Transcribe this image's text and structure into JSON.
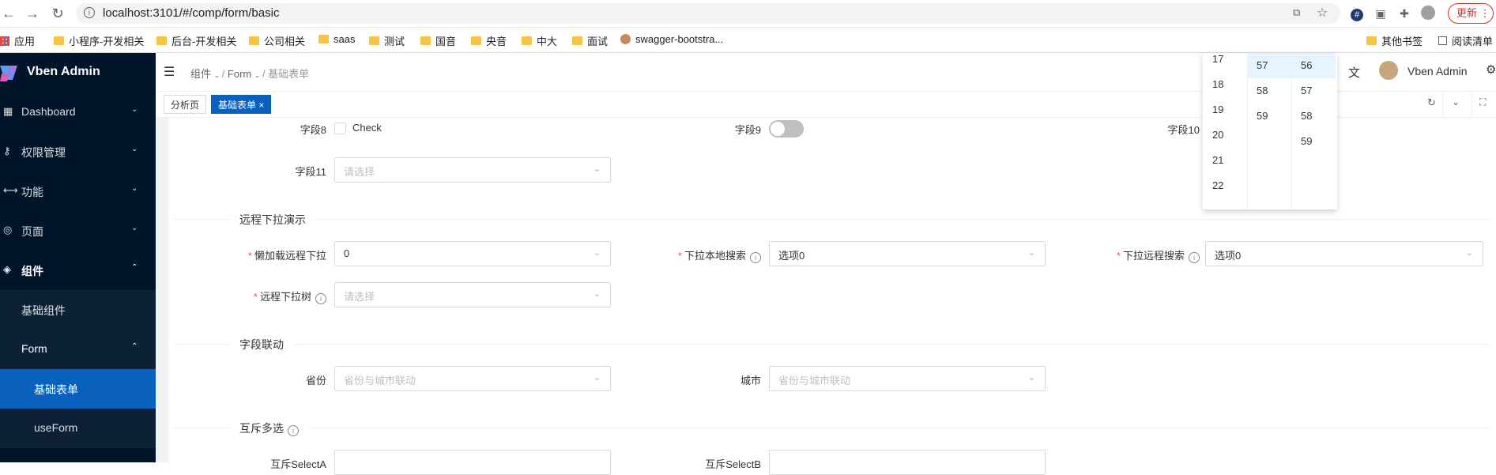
{
  "browser": {
    "url": "localhost:3101/#/comp/form/basic",
    "update_label": "更新",
    "bookmarks": [
      "应用",
      "小程序-开发相关",
      "后台-开发相关",
      "公司相关",
      "saas",
      "测试",
      "国音",
      "央音",
      "中大",
      "面试",
      "swagger-bootstra...",
      "其他书签",
      "阅读清单"
    ]
  },
  "app": {
    "title": "Vben Admin",
    "user_name": "Vben Admin"
  },
  "sidebar": {
    "items": [
      {
        "label": "Dashboard",
        "icon": "dashboard-icon",
        "chevron": "⌄"
      },
      {
        "label": "权限管理",
        "icon": "key-icon",
        "chevron": "⌄"
      },
      {
        "label": "功能",
        "icon": "function-icon",
        "chevron": "⌄"
      },
      {
        "label": "页面",
        "icon": "page-icon",
        "chevron": "⌄"
      },
      {
        "label": "组件",
        "icon": "component-icon",
        "chevron": "⌃"
      }
    ],
    "sub_items": [
      {
        "label": "基础组件"
      },
      {
        "label": "Form",
        "chevron": "⌃"
      },
      {
        "label": "基础表单"
      },
      {
        "label": "useForm"
      }
    ]
  },
  "header": {
    "breadcrumb": [
      "组件",
      "Form",
      "基础表单"
    ]
  },
  "tabs": [
    {
      "label": "分析页"
    },
    {
      "label": "基础表单",
      "close": "×"
    }
  ],
  "form": {
    "row1": {
      "field8_label": "字段8",
      "checkbox_label": "Check",
      "field9_label": "字段9",
      "field10_label": "字段10"
    },
    "field11": {
      "label": "字段11",
      "placeholder": "请选择"
    },
    "section_remote": "远程下拉演示",
    "lazy_remote": {
      "label": "懒加载远程下拉",
      "value": "0"
    },
    "local_search": {
      "label": "下拉本地搜索",
      "value": "选项0"
    },
    "remote_search": {
      "label": "下拉远程搜索",
      "value": "选项0"
    },
    "remote_tree": {
      "label": "远程下拉树",
      "placeholder": "请选择"
    },
    "section_linkage": "字段联动",
    "province": {
      "label": "省份",
      "placeholder": "省份与城市联动"
    },
    "city": {
      "label": "城市",
      "placeholder": "省份与城市联动"
    },
    "section_exclusive": "互斥多选",
    "select_a": {
      "label": "互斥SelectA"
    },
    "select_b": {
      "label": "互斥SelectB"
    }
  },
  "timepicker": {
    "hours": [
      "17",
      "18",
      "19",
      "20",
      "21",
      "22"
    ],
    "minutes": [
      "57",
      "58",
      "59"
    ],
    "seconds": [
      "56",
      "57",
      "58",
      "59"
    ]
  }
}
